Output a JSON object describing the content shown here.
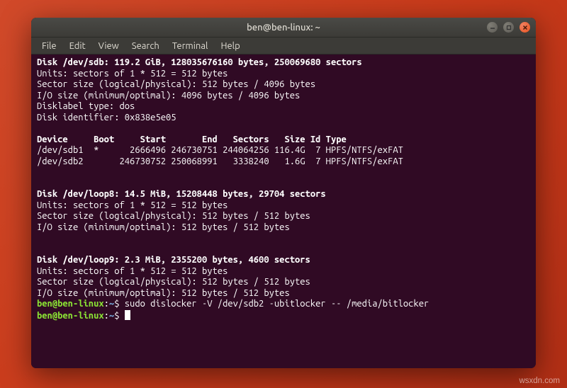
{
  "window": {
    "title": "ben@ben-linux: ~"
  },
  "menubar": {
    "items": [
      "File",
      "Edit",
      "View",
      "Search",
      "Terminal",
      "Help"
    ]
  },
  "terminal": {
    "disk_sdb_header": "Disk /dev/sdb: 119.2 GiB, 128035676160 bytes, 250069680 sectors",
    "units": "Units: sectors of 1 * 512 = 512 bytes",
    "sector_size": "Sector size (logical/physical): 512 bytes / 4096 bytes",
    "io_size": "I/O size (minimum/optimal): 4096 bytes / 4096 bytes",
    "disklabel": "Disklabel type: dos",
    "disk_id": "Disk identifier: 0x838e5e05",
    "table_header": "Device     Boot     Start       End   Sectors   Size Id Type",
    "row_sdb1": "/dev/sdb1  *      2666496 246730751 244064256 116.4G  7 HPFS/NTFS/exFAT",
    "row_sdb2": "/dev/sdb2       246730752 250068991   3338240   1.6G  7 HPFS/NTFS/exFAT",
    "disk_loop8_header": "Disk /dev/loop8: 14.5 MiB, 15208448 bytes, 29704 sectors",
    "loop_units": "Units: sectors of 1 * 512 = 512 bytes",
    "loop_sector_size": "Sector size (logical/physical): 512 bytes / 512 bytes",
    "loop_io": "I/O size (minimum/optimal): 512 bytes / 512 bytes",
    "disk_loop9_header": "Disk /dev/loop9: 2.3 MiB, 2355200 bytes, 4600 sectors",
    "loop9_units": "Units: sectors of 1 * 512 = 512 bytes",
    "loop9_sector_size": "Sector size (logical/physical): 512 bytes / 512 bytes",
    "loop9_io": "I/O size (minimum/optimal): 512 bytes / 512 bytes",
    "prompt_user_host": "ben@ben-linux",
    "prompt_sep": ":",
    "prompt_path": "~",
    "prompt_dollar": "$ ",
    "cmd1": "sudo dislocker -V /dev/sdb2 -ubitlocker -- /media/bitlocker",
    "cmd2": ""
  },
  "watermark": "wsxdn.com"
}
